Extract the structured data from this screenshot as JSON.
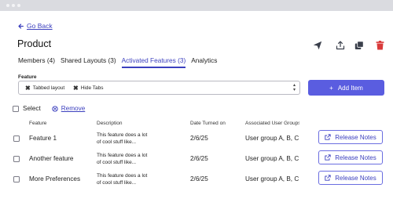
{
  "nav": {
    "back_label": "Go Back"
  },
  "page": {
    "title": "Product"
  },
  "tabs": [
    {
      "label": "Members (4)"
    },
    {
      "label": "Shared Layouts (3)"
    },
    {
      "label": "Activated Features (3)",
      "active": true
    },
    {
      "label": "Analytics"
    }
  ],
  "feature_select": {
    "label": "Feature",
    "chips": [
      {
        "label": "Tabbed layout"
      },
      {
        "label": "Hide Tabs"
      }
    ]
  },
  "add_button": {
    "label": "Add Item"
  },
  "bulk": {
    "select_label": "Select",
    "remove_label": "Remove"
  },
  "table": {
    "headers": [
      "Feature",
      "Description",
      "Date Turned on",
      "Associated User Groups"
    ],
    "rows": [
      {
        "name": "Feature 1",
        "desc_line1": "This feature does a lot",
        "desc_line2": "of cool stuff like...",
        "date": "2/6/25",
        "groups": "User group A, B, C",
        "action": "Release Notes"
      },
      {
        "name": "Another feature",
        "desc_line1": "This feature does a lot",
        "desc_line2": "of cool stuff like...",
        "date": "2/6/25",
        "groups": "User group A, B, C",
        "action": "Release Notes"
      },
      {
        "name": "More Preferences",
        "desc_line1": "This feature does a lot",
        "desc_line2": "of cool stuff like...",
        "date": "2/6/25",
        "groups": "User group A, B, C",
        "action": "Release Notes"
      }
    ]
  },
  "icons": {
    "back": "arrow-left-icon",
    "send": "send-icon",
    "share": "share-upload-icon",
    "copy": "copy-icon",
    "delete": "trash-icon",
    "plus": "plus-icon",
    "remove": "circle-x-icon",
    "release_notes": "external-link-icon"
  },
  "colors": {
    "accent": "#3b3fbe",
    "primary_button": "#5a5de0",
    "danger": "#d93a3a",
    "icon": "#3a3f4b"
  }
}
